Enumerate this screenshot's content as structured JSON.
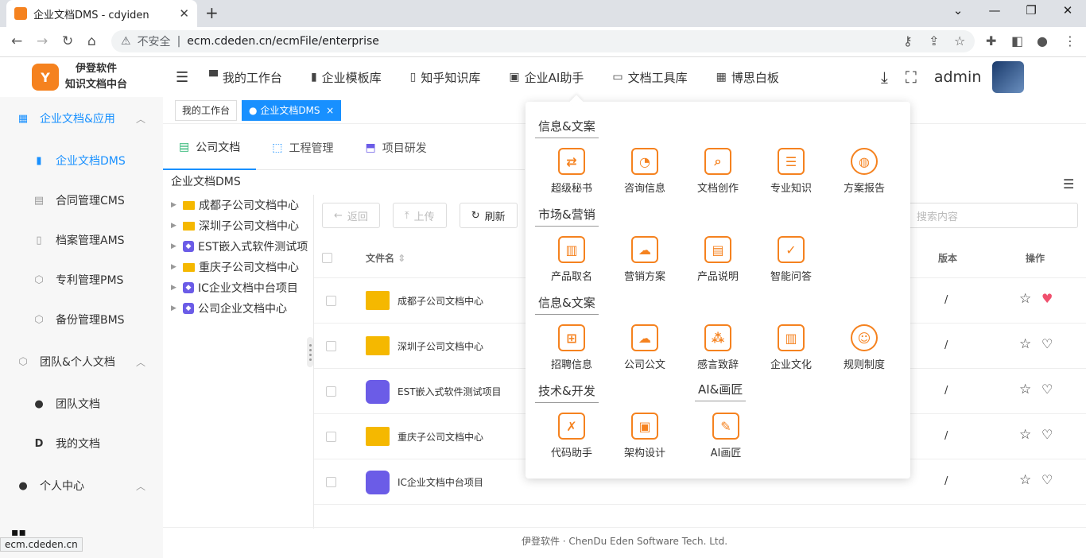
{
  "browser": {
    "tab_title": "企业文档DMS - cdyiden",
    "url_warning": "不安全",
    "url": "ecm.cdeden.cn/ecmFile/enterprise",
    "status_url": "ecm.cdeden.cn"
  },
  "logo": {
    "line1": "伊登软件",
    "line2": "知识文档中台",
    "mark": "Y"
  },
  "topnav": [
    {
      "label": "我的工作台",
      "icon": "monitor-icon"
    },
    {
      "label": "企业模板库",
      "icon": "bar-chart-icon"
    },
    {
      "label": "知乎知识库",
      "icon": "book-icon"
    },
    {
      "label": "企业AI助手",
      "icon": "chat-icon"
    },
    {
      "label": "文档工具库",
      "icon": "desktop-icon"
    },
    {
      "label": "博思白板",
      "icon": "board-icon"
    }
  ],
  "user": {
    "name": "admin"
  },
  "sidebar": {
    "group1": "企业文档&应用",
    "items1": [
      "企业文档DMS",
      "合同管理CMS",
      "档案管理AMS",
      "专利管理PMS",
      "备份管理BMS"
    ],
    "group2": "团队&个人文档",
    "items2": [
      "团队文档",
      "我的文档"
    ],
    "group3": "个人中心"
  },
  "tags": {
    "t1": "我的工作台",
    "t2": "企业文档DMS"
  },
  "page_tabs": [
    "公司文档",
    "工程管理",
    "项目研发"
  ],
  "breadcrumb": "企业文档DMS",
  "tree": [
    {
      "label": "成都子公司文档中心",
      "type": "folder"
    },
    {
      "label": "深圳子公司文档中心",
      "type": "folder"
    },
    {
      "label": "EST嵌入式软件测试项",
      "type": "project"
    },
    {
      "label": "重庆子公司文档中心",
      "type": "folder"
    },
    {
      "label": "IC企业文档中台项目",
      "type": "project"
    },
    {
      "label": "公司企业文档中心",
      "type": "project"
    }
  ],
  "toolbar": {
    "back": "返回",
    "upload": "上传",
    "refresh": "刷新",
    "search_placeholder": "搜索内容"
  },
  "table": {
    "col_name": "文件名",
    "col_version": "版本",
    "col_ops": "操作",
    "rows": [
      {
        "name": "成都子公司文档中心",
        "type": "folder",
        "version": "/",
        "favorite": true
      },
      {
        "name": "深圳子公司文档中心",
        "type": "folder",
        "version": "/",
        "favorite": false
      },
      {
        "name": "EST嵌入式软件测试项目",
        "type": "project",
        "version": "/",
        "favorite": false
      },
      {
        "name": "重庆子公司文档中心",
        "type": "folder",
        "version": "/",
        "favorite": false
      },
      {
        "name": "IC企业文档中台项目",
        "type": "project",
        "version": "/",
        "favorite": false
      }
    ]
  },
  "footer": "伊登软件 · ChenDu Eden Software Tech. Ltd.",
  "ai_menu": {
    "sections": [
      "信息&文案",
      "市场&营销",
      "信息&文案",
      "技术&开发",
      "AI&画匠"
    ],
    "items": [
      [
        "超级秘书",
        "咨询信息",
        "文档创作",
        "专业知识",
        "方案报告"
      ],
      [
        "产品取名",
        "营销方案",
        "产品说明",
        "智能问答"
      ],
      [
        "招聘信息",
        "公司公文",
        "感言致辞",
        "企业文化",
        "规则制度"
      ],
      [
        "代码助手",
        "架构设计",
        "AI画匠"
      ]
    ]
  },
  "colors": {
    "accent": "#1890ff",
    "brand": "#f5821f",
    "favorite": "#f0506e"
  }
}
